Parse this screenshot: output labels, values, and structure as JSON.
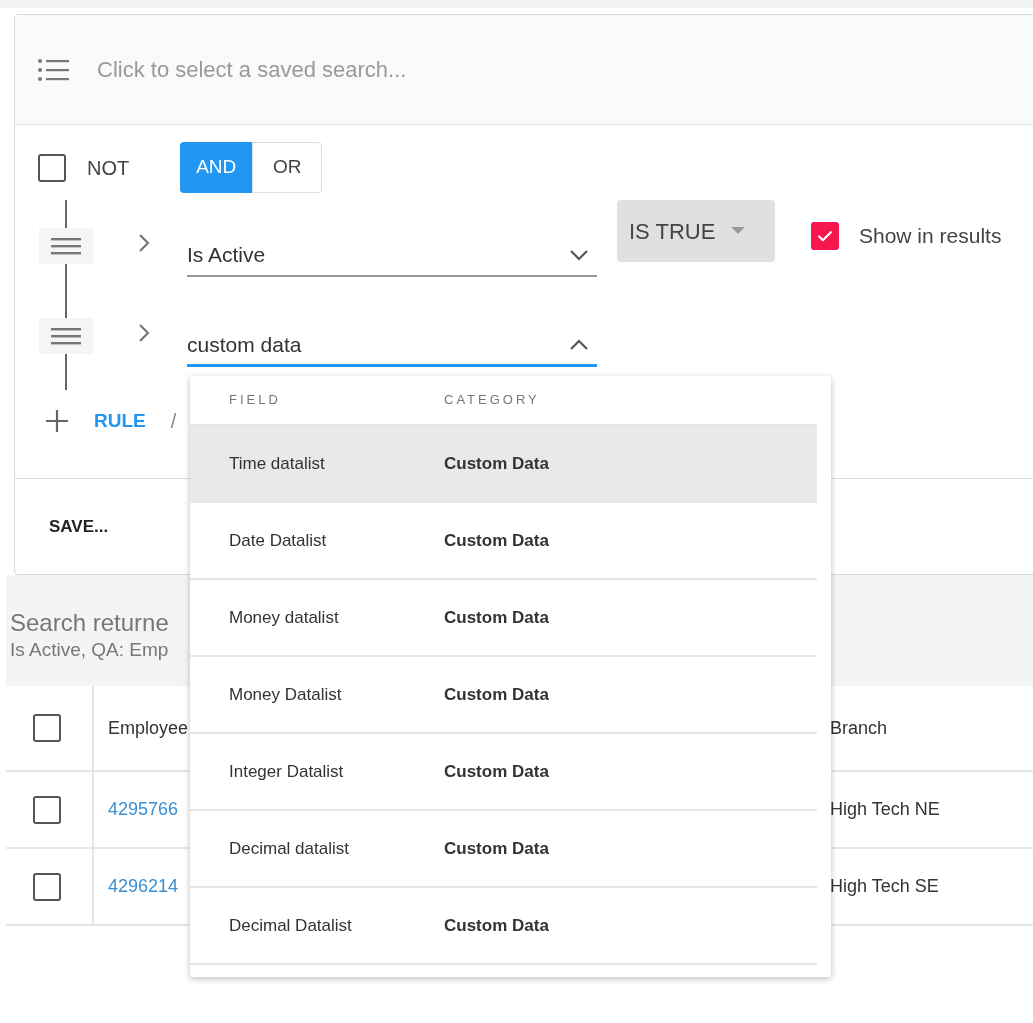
{
  "saved_search": {
    "placeholder": "Click to select a saved search..."
  },
  "group": {
    "not": {
      "label": "NOT",
      "checked": false
    },
    "operators": [
      {
        "label": "AND",
        "selected": true
      },
      {
        "label": "OR",
        "selected": false
      }
    ],
    "rules": [
      {
        "field": "Is Active",
        "open": false,
        "condition": "IS TRUE",
        "show_in_results": {
          "label": "Show in results",
          "checked": true
        }
      },
      {
        "field": "custom data",
        "open": true
      }
    ],
    "add_rule": "RULE",
    "separator": "/"
  },
  "save_button": "SAVE...",
  "results": {
    "title": "Search returne",
    "summary": "Is Active, QA: Emp"
  },
  "table": {
    "header": {
      "checked": false,
      "column_1": "Employee",
      "column_2": "Branch"
    },
    "rows": [
      {
        "checked": false,
        "column_1": "4295766",
        "column_2": "High Tech NE"
      },
      {
        "checked": false,
        "column_1": "4296214",
        "column_2": "High Tech SE"
      }
    ]
  },
  "dropdown": {
    "columns": [
      "FIELD",
      "CATEGORY"
    ],
    "options": [
      {
        "field": "Time datalist",
        "category": "Custom Data",
        "selected": true
      },
      {
        "field": "Date Datalist",
        "category": "Custom Data",
        "selected": false
      },
      {
        "field": "Money datalist",
        "category": "Custom Data",
        "selected": false
      },
      {
        "field": "Money Datalist",
        "category": "Custom Data",
        "selected": false
      },
      {
        "field": "Integer Datalist",
        "category": "Custom Data",
        "selected": false
      },
      {
        "field": "Decimal datalist",
        "category": "Custom Data",
        "selected": false
      },
      {
        "field": "Decimal Datalist",
        "category": "Custom Data",
        "selected": false
      }
    ]
  }
}
